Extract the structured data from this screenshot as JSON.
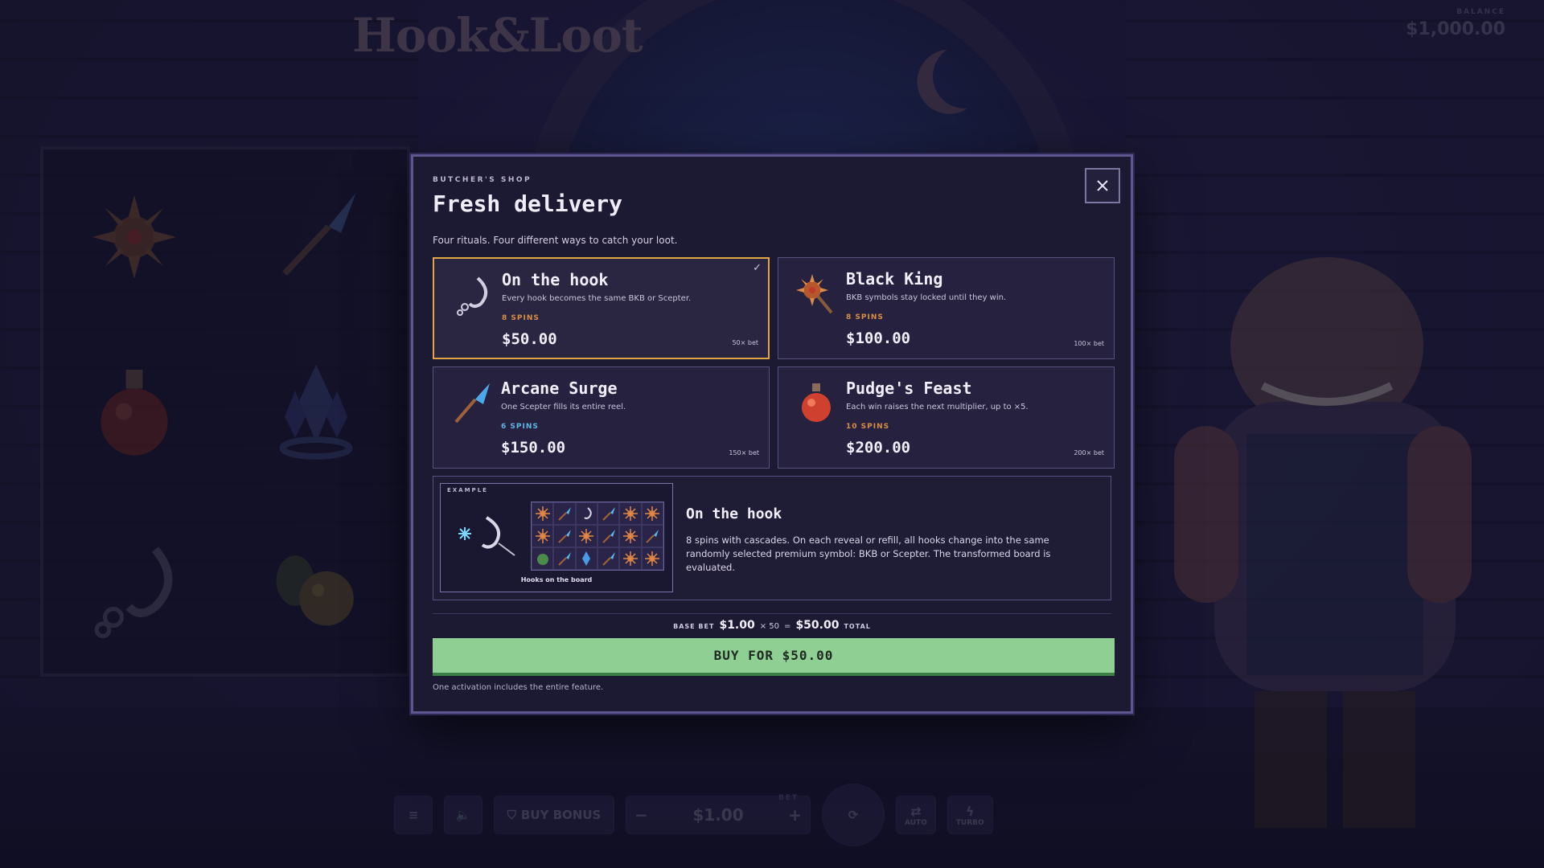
{
  "game": {
    "title": "Hook&Loot",
    "balance_label": "BALANCE",
    "balance_value": "$1,000.00"
  },
  "bottom_bar": {
    "buy_bonus_label": "BUY BONUS",
    "bet_label": "BET",
    "bet_value": "$1.00",
    "minus": "−",
    "plus": "+",
    "auto_label": "AUTO",
    "turbo_label": "TURBO"
  },
  "modal": {
    "eyebrow": "BUTCHER'S SHOP",
    "title": "Fresh delivery",
    "subtitle": "Four rituals. Four different ways to catch your loot.",
    "close_label": "×",
    "cards": [
      {
        "title": "On the hook",
        "desc": "Every hook becomes the same BKB or Scepter.",
        "spins": "8 SPINS",
        "spins_color": "#d98f44",
        "price": "$50.00",
        "mult": "50× bet",
        "selected": true,
        "icon": "hook-icon"
      },
      {
        "title": "Black King",
        "desc": "BKB symbols stay locked until they win.",
        "spins": "8 SPINS",
        "spins_color": "#d98f44",
        "price": "$100.00",
        "mult": "100× bet",
        "selected": false,
        "icon": "spiked-mace-icon"
      },
      {
        "title": "Arcane Surge",
        "desc": "One Scepter fills its entire reel.",
        "spins": "6 SPINS",
        "spins_color": "#5fb6e8",
        "price": "$150.00",
        "mult": "150× bet",
        "selected": false,
        "icon": "scepter-icon"
      },
      {
        "title": "Pudge's Feast",
        "desc": "Each win raises the next multiplier, up to ×5.",
        "spins": "10 SPINS",
        "spins_color": "#d98f44",
        "price": "$200.00",
        "mult": "200× bet",
        "selected": false,
        "icon": "potion-icon"
      }
    ],
    "example": {
      "tag": "EXAMPLE",
      "caption": "Hooks on the board",
      "title": "On the hook",
      "desc": "8 spins with cascades. On each reveal or refill, all hooks change into the same randomly selected premium symbol: BKB or Scepter. The transformed board is evaluated."
    },
    "bet_summary": {
      "base_label": "BASE BET",
      "base_value": "$1.00",
      "times": "× 50",
      "equals": "=",
      "total_value": "$50.00",
      "total_label": "TOTAL"
    },
    "buy_button": "BUY FOR $50.00",
    "footnote": "One activation includes the entire feature."
  },
  "colors": {
    "selected_border": "#e0a641",
    "buy_button": "#8fcf93",
    "modal_border": "#5d5690"
  }
}
